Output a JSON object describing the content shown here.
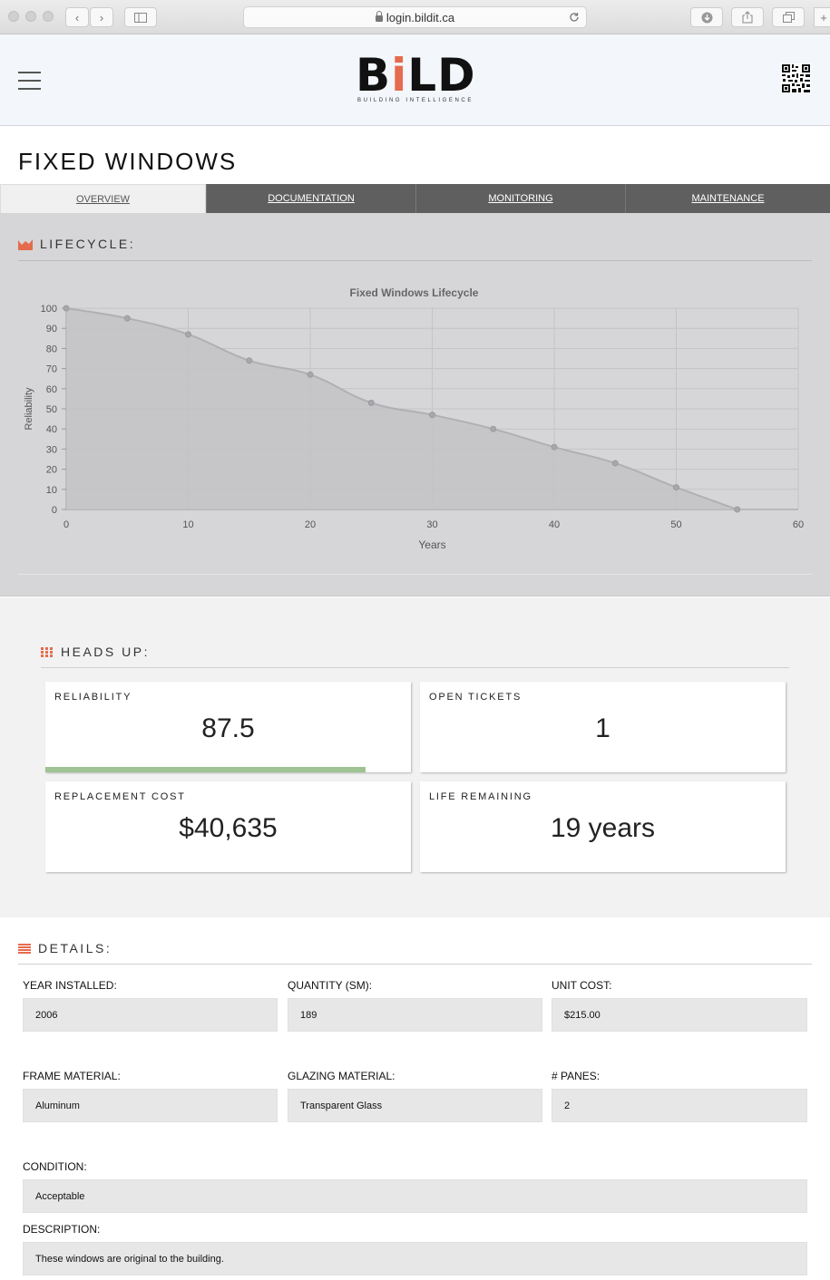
{
  "browser": {
    "url": "login.bildit.ca"
  },
  "header": {
    "logo_text_1": "B",
    "logo_text_i": "i",
    "logo_text_2": "LD",
    "logo_subtitle": "BUILDING INTELLIGENCE"
  },
  "page": {
    "title": "FIXED WINDOWS"
  },
  "tabs": [
    {
      "label": "OVERVIEW",
      "active": true
    },
    {
      "label": "DOCUMENTATION",
      "active": false
    },
    {
      "label": "MONITORING",
      "active": false
    },
    {
      "label": "MAINTENANCE",
      "active": false
    }
  ],
  "lifecycle": {
    "heading": "LIFECYCLE:"
  },
  "chart_data": {
    "type": "area",
    "title": "Fixed Windows Lifecycle",
    "xlabel": "Years",
    "ylabel": "Reliability",
    "xlim": [
      0,
      60
    ],
    "ylim": [
      0,
      100
    ],
    "xticks": [
      0,
      10,
      20,
      30,
      40,
      50,
      60
    ],
    "yticks": [
      0,
      10,
      20,
      30,
      40,
      50,
      60,
      70,
      80,
      90,
      100
    ],
    "grid": true,
    "series": [
      {
        "x": [
          0,
          5,
          10,
          15,
          20,
          25,
          30,
          35,
          40,
          45,
          50,
          55
        ],
        "values": [
          100,
          95,
          87,
          74,
          67,
          53,
          47,
          40,
          31,
          23,
          11,
          0
        ]
      }
    ],
    "colors": {
      "fill": "#c3c3c6",
      "line": "#b0b0b4",
      "point": "#a8a8ac"
    }
  },
  "headsup": {
    "heading": "HEADS UP:",
    "cards": [
      {
        "label": "RELIABILITY",
        "value": "87.5",
        "progress": 0.875
      },
      {
        "label": "OPEN TICKETS",
        "value": "1"
      },
      {
        "label": "REPLACEMENT COST",
        "value": "$40,635"
      },
      {
        "label": "LIFE REMAINING",
        "value": "19 years"
      }
    ]
  },
  "details": {
    "heading": "DETAILS:",
    "fields": [
      {
        "label": "YEAR INSTALLED:",
        "value": "2006"
      },
      {
        "label": "QUANTITY (SM):",
        "value": "189"
      },
      {
        "label": "UNIT COST:",
        "value": "$215.00"
      },
      {
        "label": "FRAME MATERIAL:",
        "value": "Aluminum"
      },
      {
        "label": "GLAZING MATERIAL:",
        "value": "Transparent Glass"
      },
      {
        "label": "# PANES:",
        "value": "2"
      },
      {
        "label": "CONDITION:",
        "value": "Acceptable"
      },
      {
        "label": "DESCRIPTION:",
        "value": "These windows are original to the building."
      }
    ]
  },
  "colors": {
    "accent": "#e56b4e",
    "tab_dark": "#5f5f5f",
    "progress": "#9fc393"
  }
}
